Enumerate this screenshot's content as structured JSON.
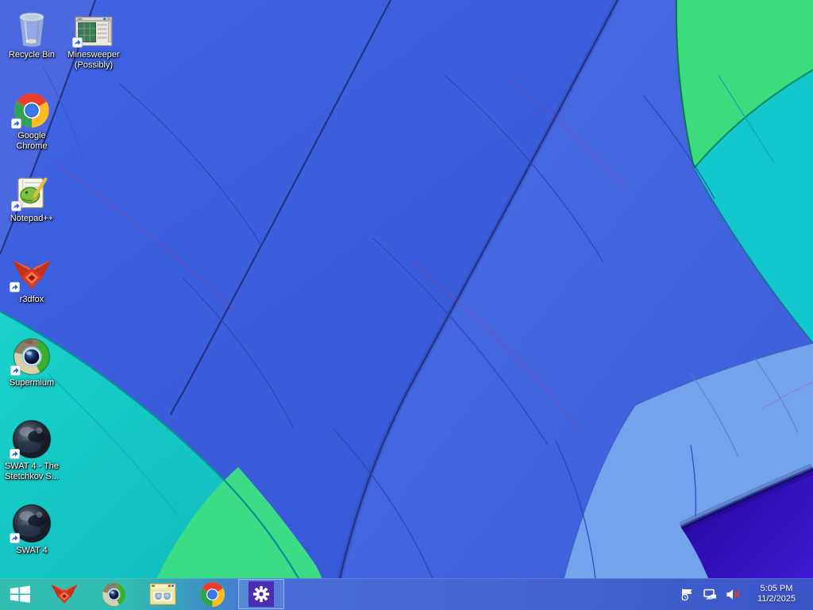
{
  "wallpaper": {
    "subject": "hot air balloon canopy fanning from lower-left",
    "colors": {
      "royal_blue": "#3a5ede",
      "right_gore_blue": "#4568e6",
      "periwinkle_corner": "#4c68e0",
      "cyan": "#14cbc6",
      "green": "#3ddc84",
      "light_blue_panel": "#74a2ec",
      "purple_fold": "#3418c2",
      "seam": "#1e2f7e"
    }
  },
  "desktop": {
    "icons": [
      {
        "id": "recycle-bin",
        "label": "Recycle Bin"
      },
      {
        "id": "minesweeper",
        "label": "Minesweeper (Possibly)"
      },
      {
        "id": "google-chrome",
        "label": "Google Chrome"
      },
      {
        "id": "notepad-plus-plus",
        "label": "Notepad++"
      },
      {
        "id": "r3dfox",
        "label": "r3dfox"
      },
      {
        "id": "supermium",
        "label": "Supermium"
      },
      {
        "id": "swat4-stetchkov",
        "label": "SWAT 4 - The Stetchkov S..."
      },
      {
        "id": "swat4",
        "label": "SWAT 4"
      }
    ]
  },
  "taskbar": {
    "accent_teal": "#31bdb2",
    "accent_blue": "#4463d0",
    "start": {
      "icon": "windows-logo-icon"
    },
    "pinned": [
      {
        "id": "r3dfox",
        "icon": "r3dfox-icon"
      },
      {
        "id": "supermium",
        "icon": "supermium-icon"
      },
      {
        "id": "file-explorer",
        "icon": "folder-window-icon"
      },
      {
        "id": "google-chrome",
        "icon": "chrome-icon"
      },
      {
        "id": "settings",
        "icon": "gear-icon",
        "active": true,
        "tile_color": "#4b2db3"
      }
    ],
    "tray": {
      "icons": [
        "action-center-flag-icon",
        "network-wired-icon",
        "volume-muted-icon"
      ],
      "time": "5:05 PM",
      "date": "11/2/2025"
    }
  }
}
